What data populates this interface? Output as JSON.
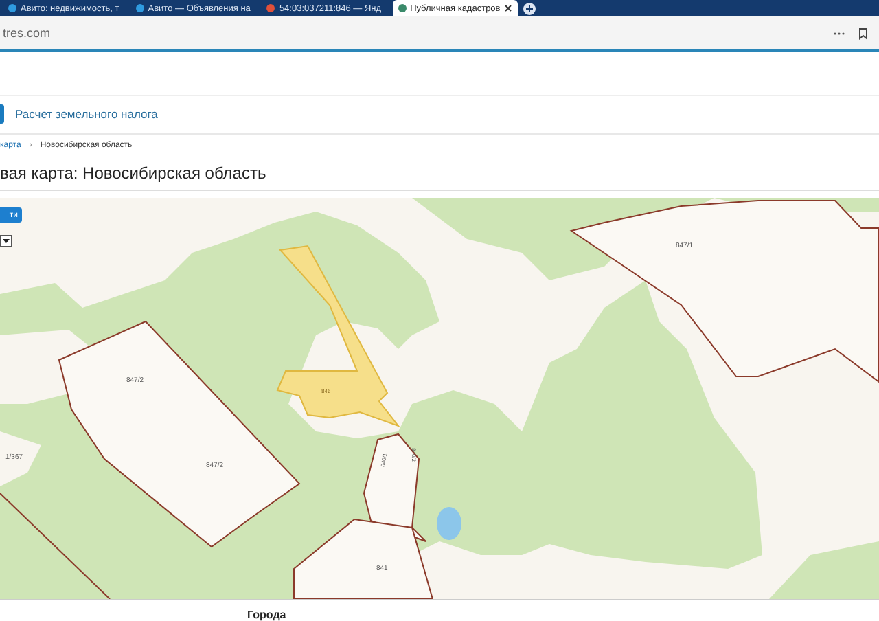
{
  "browser": {
    "tabs": [
      {
        "label": "Авито: недвижимость, т",
        "selected": false,
        "color": "#2f9be0"
      },
      {
        "label": "Авито — Объявления на",
        "selected": false,
        "color": "#2f9be0"
      },
      {
        "label": "54:03:037211:846 — Янд",
        "selected": false,
        "color": "#e0503a"
      },
      {
        "label": "Публичная кадастров",
        "selected": true,
        "color": "#3a8a6a"
      }
    ],
    "address": "tres.com"
  },
  "nav": {
    "item": "Расчет земельного налога"
  },
  "breadcrumbs": [
    "карта",
    "Новосибирская область"
  ],
  "breadcrumb_separator": "›",
  "title": "вая карта: Новосибирская область",
  "map": {
    "search_button": "ти",
    "labels": [
      {
        "text": "847/2",
        "kind": "parcel"
      },
      {
        "text": "847/2",
        "kind": "parcel"
      },
      {
        "text": "846",
        "kind": "selected"
      },
      {
        "text": "847/1",
        "kind": "parcel"
      },
      {
        "text": "840/2",
        "kind": "vertical"
      },
      {
        "text": "840/1",
        "kind": "vertical"
      },
      {
        "text": "841",
        "kind": "parcel"
      },
      {
        "text": "1/367",
        "kind": "parcel"
      }
    ]
  },
  "footer": {
    "caption": "Города"
  }
}
